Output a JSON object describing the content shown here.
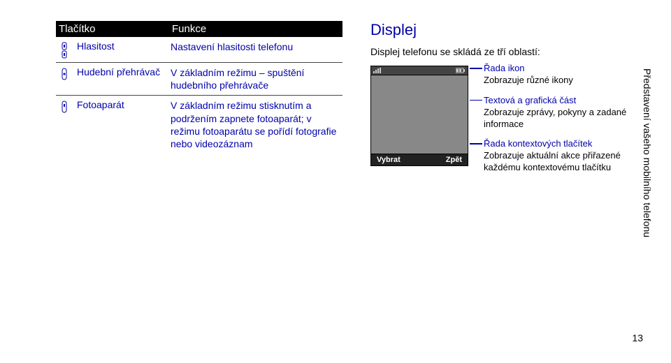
{
  "sideTab": "Představení vašeho mobilního telefonu",
  "pageNumber": "13",
  "table": {
    "headers": {
      "button": "Tlačítko",
      "function": "Funkce"
    },
    "rows": [
      {
        "label": "Hlasitost",
        "desc": "Nastavení hlasitosti telefonu"
      },
      {
        "label": "Hudební přehrávač",
        "desc": "V základním režimu – spuštění hudebního přehrávače"
      },
      {
        "label": "Fotoaparát",
        "desc": "V základním režimu stisknutím a podržením zapnete fotoaparát; v režimu fotoaparátu se pořídí fotografie nebo videozáznam"
      }
    ]
  },
  "display": {
    "title": "Displej",
    "intro": "Displej telefonu se skládá ze tří oblastí:",
    "softkeys": {
      "left": "Vybrat",
      "right": "Zpět"
    },
    "annotations": [
      {
        "title": "Řada ikon",
        "desc": "Zobrazuje různé ikony"
      },
      {
        "title": "Textová a grafická část",
        "desc": "Zobrazuje zprávy, pokyny a zadané informace"
      },
      {
        "title": "Řada kontextových tlačítek",
        "desc": "Zobrazuje aktuální akce přiřazené každému kontextovému tlačítku"
      }
    ]
  }
}
